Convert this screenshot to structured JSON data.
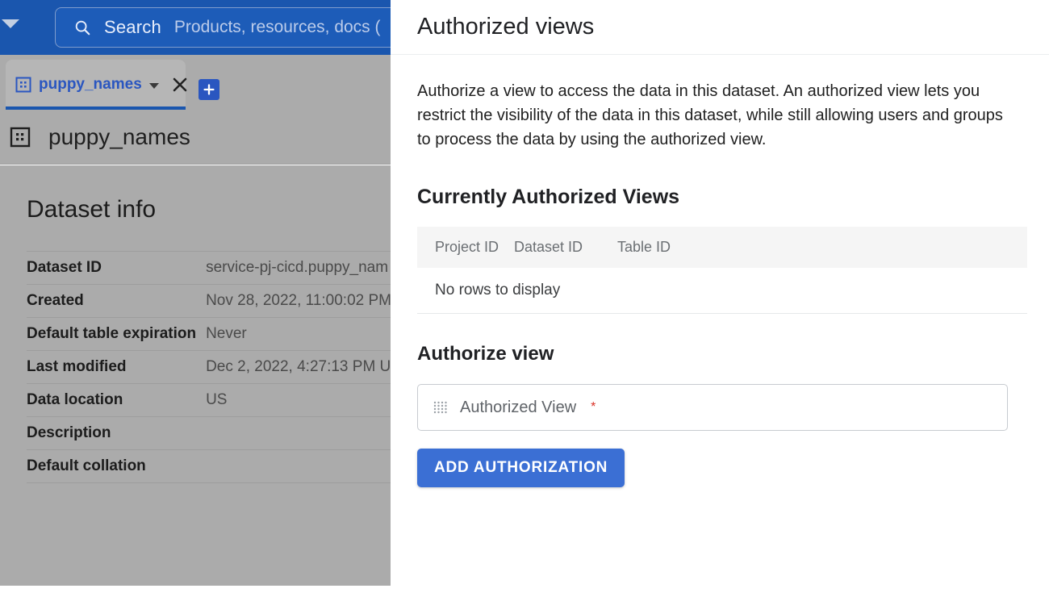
{
  "topbar": {
    "account_caret_icon": "chevron-down-icon",
    "search_icon": "search-icon",
    "search_label": "Search",
    "search_placeholder": "Products, resources, docs ("
  },
  "tabs": {
    "active_tab": {
      "icon": "dataset-icon",
      "label": "puppy_names",
      "caret_icon": "chevron-down-icon",
      "close_icon": "close-icon"
    },
    "add_tab_icon": "plus-icon"
  },
  "page": {
    "icon": "dataset-icon",
    "title": "puppy_names"
  },
  "dataset_info": {
    "heading": "Dataset info",
    "rows": [
      {
        "key": "Dataset ID",
        "value": "service-pj-cicd.puppy_nam"
      },
      {
        "key": "Created",
        "value": "Nov 28, 2022, 11:00:02 PM"
      },
      {
        "key": "Default table expiration",
        "value": "Never"
      },
      {
        "key": "Last modified",
        "value": "Dec 2, 2022, 4:27:13 PM U"
      },
      {
        "key": "Data location",
        "value": "US"
      },
      {
        "key": "Description",
        "value": ""
      },
      {
        "key": "Default collation",
        "value": ""
      }
    ]
  },
  "panel": {
    "title": "Authorized views",
    "description": "Authorize a view to access the data in this dataset. An authorized view lets you restrict the visibility of the data in this dataset, while still allowing users and groups to process the data by using the authorized view.",
    "current_section_heading": "Currently Authorized Views",
    "table": {
      "columns": [
        "Project ID",
        "Dataset ID",
        "Table ID"
      ],
      "empty_message": "No rows to display",
      "rows": []
    },
    "authorize_section_heading": "Authorize view",
    "authorized_view_field": {
      "icon": "dot-grid-icon",
      "placeholder": "Authorized View",
      "required_marker": "*",
      "value": ""
    },
    "add_authorization_label": "ADD AUTHORIZATION"
  },
  "colors": {
    "topbar_blue": "#1a56ae",
    "tab_link_blue": "#2a56c0",
    "primary_button_blue": "#3b6fd4",
    "required_red": "#d93025",
    "scrim_gray": "#ababab",
    "table_header_gray": "#f5f5f5"
  }
}
